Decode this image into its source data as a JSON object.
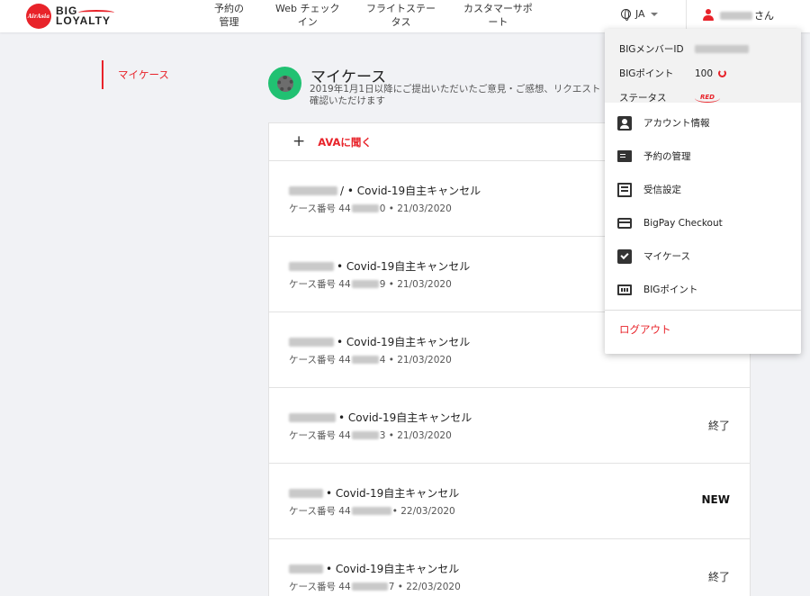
{
  "header": {
    "logo_badge": "AirAsia",
    "logo_line1": "BIG",
    "logo_line2": "LOYALTY",
    "nav": [
      {
        "l1": "予約の",
        "l2": "管理"
      },
      {
        "l1": "Web チェック",
        "l2": "イン"
      },
      {
        "l1": "フライトステー",
        "l2": "タス"
      },
      {
        "l1": "カスタマーサポ",
        "l2": "ート"
      }
    ],
    "language": "JA",
    "user_suffix": "さん"
  },
  "sidebar": {
    "items": [
      {
        "label": "マイケース",
        "active": true
      }
    ]
  },
  "main": {
    "title": "マイケース",
    "subtitle": "2019年1月1日以降にご提出いただいたご意見・ご感想、リクエスト ご確認いただけます",
    "ask_ava": "AVAに聞く",
    "cases": [
      {
        "title": "/ • Covid-19自主キャンセル",
        "case_prefix": "ケース番号 44",
        "case_suffix": "0 • 21/03/2020",
        "status": ""
      },
      {
        "title": "• Covid-19自主キャンセル",
        "case_prefix": "ケース番号 44",
        "case_suffix": "9 • 21/03/2020",
        "status": ""
      },
      {
        "title": "• Covid-19自主キャンセル",
        "case_prefix": "ケース番号 44",
        "case_suffix": "4 • 21/03/2020",
        "status": ""
      },
      {
        "title": "• Covid-19自主キャンセル",
        "case_prefix": "ケース番号 44",
        "case_suffix": "3 • 21/03/2020",
        "status": "終了"
      },
      {
        "title": "• Covid-19自主キャンセル",
        "case_prefix": "ケース番号 44",
        "case_suffix": "• 22/03/2020",
        "status": "NEW"
      },
      {
        "title": "• Covid-19自主キャンセル",
        "case_prefix": "ケース番号 44",
        "case_suffix": "7 • 22/03/2020",
        "status": "終了"
      }
    ]
  },
  "dropdown": {
    "member_id_label": "BIGメンバーID",
    "points_label": "BIGポイント",
    "points_value": "100",
    "status_label": "ステータス",
    "status_value": "RED",
    "menu": [
      {
        "label": "アカウント情報",
        "icon": "account-icon"
      },
      {
        "label": "予約の管理",
        "icon": "booking-icon"
      },
      {
        "label": "受信設定",
        "icon": "subscription-icon"
      },
      {
        "label": "BigPay Checkout",
        "icon": "credit-card-icon"
      },
      {
        "label": "マイケース",
        "icon": "clipboard-check-icon"
      },
      {
        "label": "BIGポイント",
        "icon": "points-icon"
      }
    ],
    "logout": "ログアウト"
  },
  "colors": {
    "accent": "#e8232a",
    "case_icon_bg": "#21c172",
    "page_bg": "#f1f2f5"
  }
}
